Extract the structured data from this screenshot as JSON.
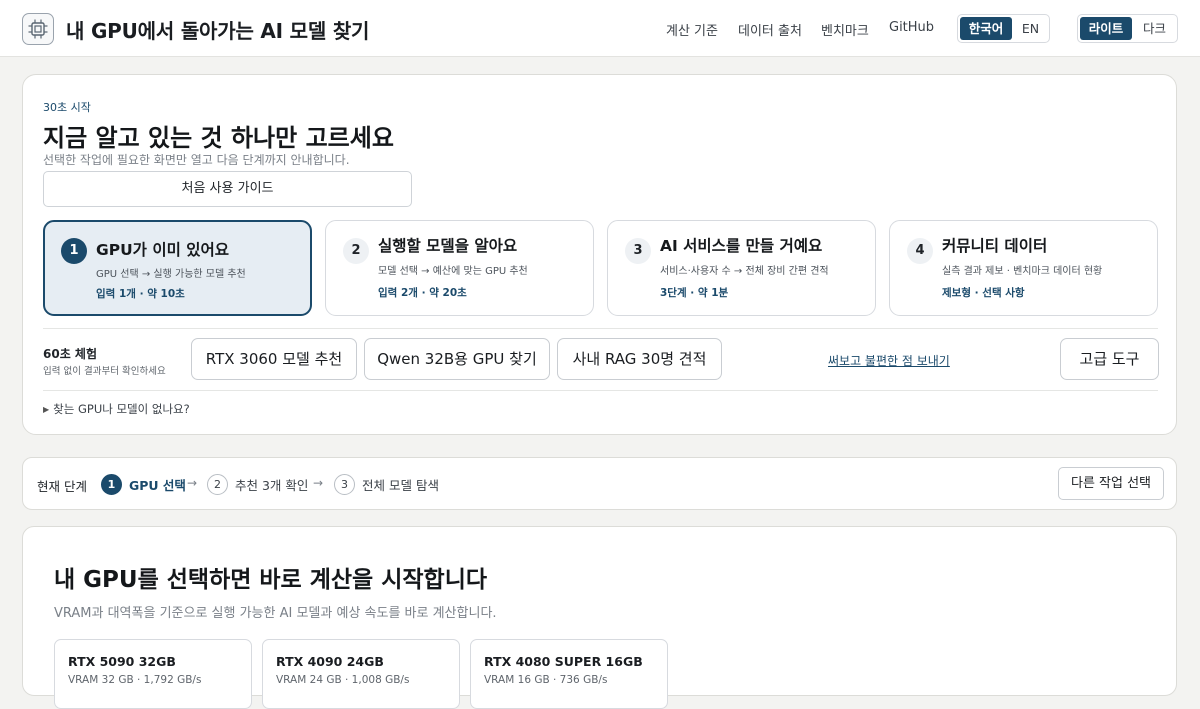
{
  "header": {
    "title": "내 GPU에서 돌아가는 AI 모델 찾기",
    "logo_icon": "gpu-chip-icon",
    "nav": [
      "계산 기준",
      "데이터 출처",
      "벤치마크",
      "GitHub"
    ],
    "language": {
      "options": [
        "한국어",
        "EN"
      ],
      "selected": "한국어"
    },
    "theme": {
      "options": [
        "라이트",
        "다크"
      ],
      "selected": "라이트"
    }
  },
  "hero": {
    "eyebrow": "30초 시작",
    "title": "지금 알고 있는 것 하나만 고르세요",
    "subtitle": "선택한 작업에 필요한 화면만 열고 다음 단계까지 안내합니다.",
    "guide_button": "처음 사용 가이드",
    "choices": [
      {
        "num": "1",
        "title": "GPU가 이미 있어요",
        "desc": "GPU 선택 → 실행 가능한 모델 추천",
        "meta": "입력 1개 · 약 10초",
        "active": true
      },
      {
        "num": "2",
        "title": "실행할 모델을 알아요",
        "desc": "모델 선택 → 예산에 맞는 GPU 추천",
        "meta": "입력 2개 · 약 20초",
        "active": false
      },
      {
        "num": "3",
        "title": "AI 서비스를 만들 거예요",
        "desc": "서비스·사용자 수 → 전체 장비 간편 견적",
        "meta": "3단계 · 약 1분",
        "active": false
      },
      {
        "num": "4",
        "title": "커뮤니티 데이터",
        "desc": "실측 결과 제보 · 벤치마크 데이터 현황",
        "meta": "제보형 · 선택 사항",
        "active": false
      }
    ],
    "demo": {
      "label": "60초 체험",
      "sub": "입력 없이 결과부터 확인하세요",
      "buttons": [
        "RTX 3060 모델 추천",
        "Qwen 32B용 GPU 찾기",
        "사내 RAG 30명 견적"
      ]
    },
    "feedback_link": "써보고 불편한 점 보내기",
    "advanced_button": "고급 도구",
    "disclosure": "찾는 GPU나 모델이 없나요?"
  },
  "stepper": {
    "label": "현재 단계",
    "steps": [
      {
        "num": "1",
        "label": "GPU 선택",
        "active": true
      },
      {
        "num": "2",
        "label": "추천 3개 확인",
        "active": false
      },
      {
        "num": "3",
        "label": "전체 모델 탐색",
        "active": false
      }
    ],
    "other_button": "다른 작업 선택"
  },
  "main": {
    "title": "내 GPU를 선택하면 바로 계산을 시작합니다",
    "subtitle": "VRAM과 대역폭을 기준으로 실행 가능한 AI 모델과 예상 속도를 바로 계산합니다.",
    "gpus": [
      {
        "name": "RTX 5090 32GB",
        "spec": "VRAM 32 GB · 1,792 GB/s"
      },
      {
        "name": "RTX 4090 24GB",
        "spec": "VRAM 24 GB · 1,008 GB/s"
      },
      {
        "name": "RTX 4080 SUPER 16GB",
        "spec": "VRAM 16 GB · 736 GB/s"
      }
    ]
  },
  "colors": {
    "accent": "#1b4a6b",
    "active_bg": "#e6edf3",
    "page_bg": "#f3f3f1"
  }
}
